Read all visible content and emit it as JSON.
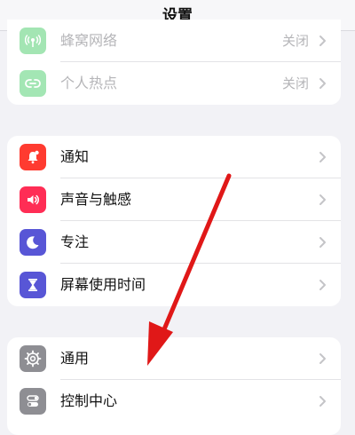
{
  "nav": {
    "title": "设置"
  },
  "group1": {
    "items": [
      {
        "label": "蜂窝网络",
        "value": "关闭",
        "icon": "antenna-icon",
        "color": "#34c759",
        "disabled": true
      },
      {
        "label": "个人热点",
        "value": "关闭",
        "icon": "hotspot-link-icon",
        "color": "#34c759",
        "disabled": true
      }
    ]
  },
  "group2": {
    "items": [
      {
        "label": "通知",
        "icon": "bell-icon",
        "color": "#ff3b30"
      },
      {
        "label": "声音与触感",
        "icon": "speaker-icon",
        "color": "#ff2d55"
      },
      {
        "label": "专注",
        "icon": "moon-icon",
        "color": "#5856d6"
      },
      {
        "label": "屏幕使用时间",
        "icon": "hourglass-icon",
        "color": "#5856d6"
      }
    ]
  },
  "group3": {
    "items": [
      {
        "label": "通用",
        "icon": "gear-icon",
        "color": "#8e8e93"
      },
      {
        "label": "控制中心",
        "icon": "toggles-icon",
        "color": "#8e8e93"
      }
    ]
  },
  "annotation": {
    "arrow_color": "#e01818"
  }
}
